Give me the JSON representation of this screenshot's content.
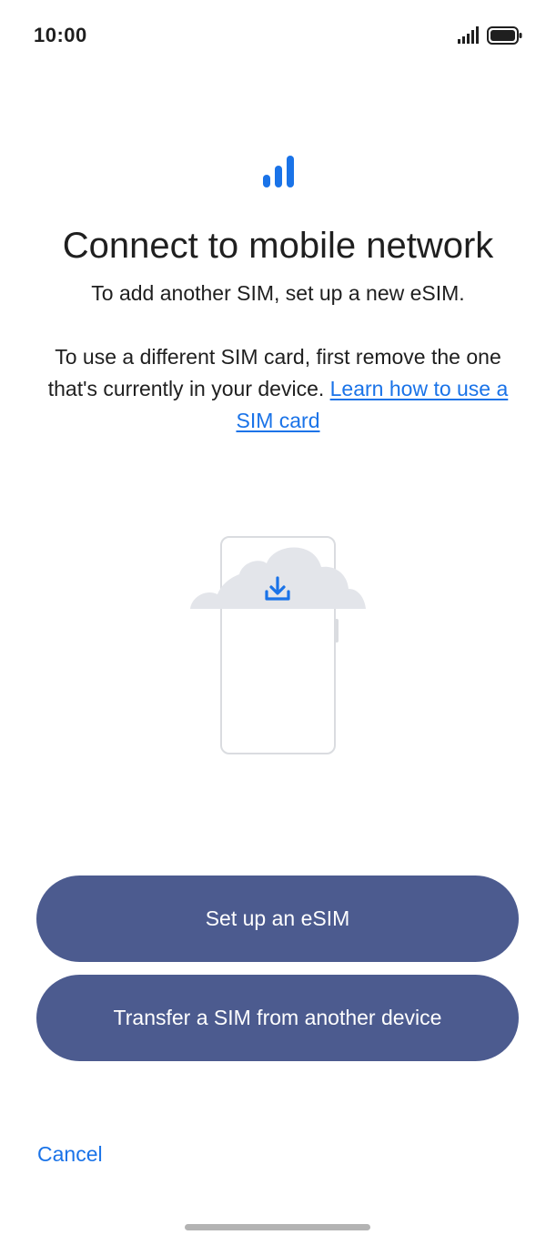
{
  "status_bar": {
    "time": "10:00",
    "signal_icon": "signal-bars-icon",
    "battery_icon": "battery-full-icon"
  },
  "header": {
    "icon": "mobile-network-signal-icon",
    "title": "Connect to mobile network",
    "subtitle": "To add another SIM, set up a new eSIM."
  },
  "body": {
    "text": "To use a different SIM card, first remove the one that's currently in your device.",
    "link_label": "Learn how to use a SIM card"
  },
  "illustration": {
    "icon": "cloud-download-phone-icon"
  },
  "actions": {
    "setup_esim_label": "Set up an eSIM",
    "transfer_sim_label": "Transfer a SIM from another device",
    "cancel_label": "Cancel"
  },
  "colors": {
    "accent": "#1a73e8",
    "button_bg": "#4c5b8f",
    "button_text": "#ffffff",
    "text_primary": "#1f1f1f",
    "illustration_cloud": "#e3e5ea",
    "illustration_outline": "#dadce0"
  }
}
